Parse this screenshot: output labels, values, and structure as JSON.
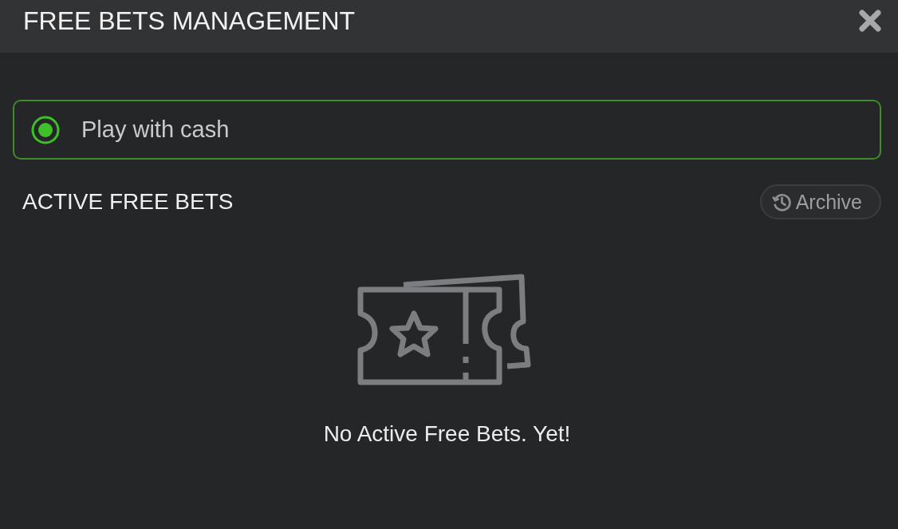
{
  "window": {
    "title": "FREE BETS MANAGEMENT"
  },
  "options": [
    {
      "label": "Play with cash",
      "selected": true
    }
  ],
  "section": {
    "title": "ACTIVE FREE BETS",
    "archive_button": "Archive"
  },
  "empty_state": {
    "message": "No Active Free Bets. Yet!"
  }
}
